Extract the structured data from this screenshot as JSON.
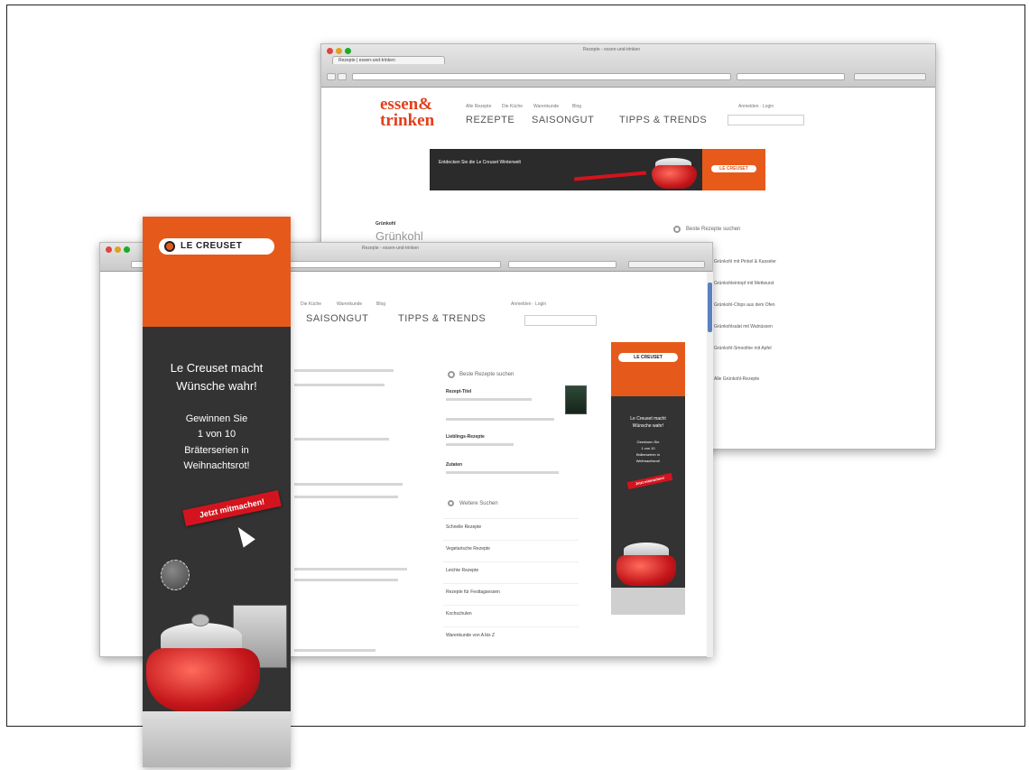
{
  "colors": {
    "brand": "#e2401c",
    "ad_orange": "#e55a1a",
    "cta_red": "#d3141e",
    "ad_dark": "#333333"
  },
  "back_window": {
    "tab_label": "Rezepte | essen-und-trinken",
    "window_title": "Rezepte - essen-und-trinken",
    "logo_line1": "essen&",
    "logo_line2": "trinken",
    "top_links": [
      "Alle Rezepte",
      "Die Küche",
      "Warenkunde",
      "Blog"
    ],
    "main_nav": [
      "REZEPTE",
      "SAISONGUT",
      "TIPPS & TRENDS"
    ],
    "account_links": "Anmelden · Login",
    "banner_text": "Entdecken Sie die Le Creuset Winterwelt",
    "banner_cta": "LE CREUSET",
    "kicker": "Grünkohl",
    "section_title": "Grünkohl",
    "sidebox_title": "Beste Rezepte suchen",
    "links": [
      "Grünkohl mit Pinkel & Kasseler",
      "Grünkohleintopf mit Mettwurst",
      "Grünkohl-Chips aus dem Ofen",
      "Grünkohlsalat mit Walnüssen",
      "Grünkohl-Smoothie mit Apfel",
      "Alle Grünkohl-Rezepte"
    ]
  },
  "front_window": {
    "window_title": "Rezepte - essen-und-trinken",
    "account_links": "Anmelden · Login",
    "top_links": [
      "Die Küche",
      "Warenkunde",
      "Blog"
    ],
    "main_nav": [
      "SAISONGUT",
      "TIPPS & TRENDS"
    ],
    "sidebox_title": "Beste Rezepte suchen",
    "sidebox_labels": [
      "Rezept-Titel",
      "Lieblings-Rezepte",
      "Zutaten"
    ],
    "sidebox_sub": "Weitere Suchen",
    "list_items": [
      "Schnelle Rezepte",
      "Vegetarische Rezepte",
      "Leichte Rezepte",
      "Rezepte für Festtagsessen",
      "Kochschulen",
      "Warenkunde von A bis Z"
    ]
  },
  "skyscraper": {
    "brand": "LE CREUSET",
    "headline": [
      "Le Creuset macht",
      "Wünsche wahr!"
    ],
    "body": [
      "Gewinnen Sie",
      "1 von 10",
      "Bräterserien in",
      "Weihnachtsrot!"
    ],
    "cta": "Jetzt mitmachen!"
  }
}
